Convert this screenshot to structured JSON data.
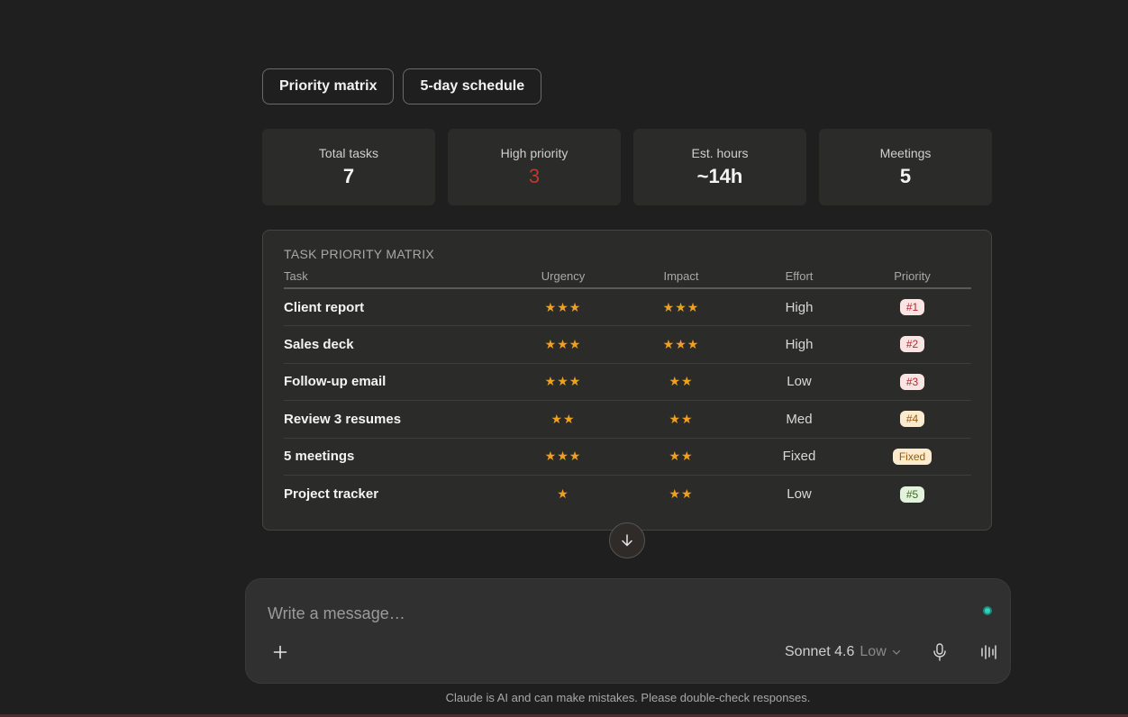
{
  "tabs": [
    {
      "label": "Priority matrix"
    },
    {
      "label": "5-day schedule"
    }
  ],
  "stats": [
    {
      "label": "Total tasks",
      "value": "7"
    },
    {
      "label": "High priority",
      "value": "3"
    },
    {
      "label": "Est. hours",
      "value": "~14h"
    },
    {
      "label": "Meetings",
      "value": "5"
    }
  ],
  "matrix": {
    "title": "TASK PRIORITY MATRIX",
    "columns": [
      "Task",
      "Urgency",
      "Impact",
      "Effort",
      "Priority"
    ],
    "rows": [
      {
        "task": "Client report",
        "urgency": "★★★",
        "impact": "★★★",
        "effort": "High",
        "priority": "#1"
      },
      {
        "task": "Sales deck",
        "urgency": "★★★",
        "impact": "★★★",
        "effort": "High",
        "priority": "#2"
      },
      {
        "task": "Follow-up email",
        "urgency": "★★★",
        "impact": "★★",
        "effort": "Low",
        "priority": "#3"
      },
      {
        "task": "Review 3 resumes",
        "urgency": "★★",
        "impact": "★★",
        "effort": "Med",
        "priority": "#4"
      },
      {
        "task": "5 meetings",
        "urgency": "★★★",
        "impact": "★★",
        "effort": "Fixed",
        "priority": "Fixed"
      },
      {
        "task": "Project tracker",
        "urgency": "★",
        "impact": "★★",
        "effort": "Low",
        "priority": "#5"
      }
    ]
  },
  "composer": {
    "placeholder": "Write a message…",
    "model": "Sonnet 4.6",
    "effort": "Low"
  },
  "disclaimer": "Claude is AI and can make mistakes. Please double-check responses.",
  "icons": {
    "scroll": "arrow-down-icon",
    "plus": "plus-icon",
    "mic": "microphone-icon",
    "voice": "voice-waveform-icon",
    "chevron": "chevron-down-icon"
  },
  "colors": {
    "background": "#1f1f1f",
    "card": "#2b2b2a",
    "star": "#f0a020",
    "high_priority": "#c0392b",
    "status_dot": "#2dd4bf"
  }
}
